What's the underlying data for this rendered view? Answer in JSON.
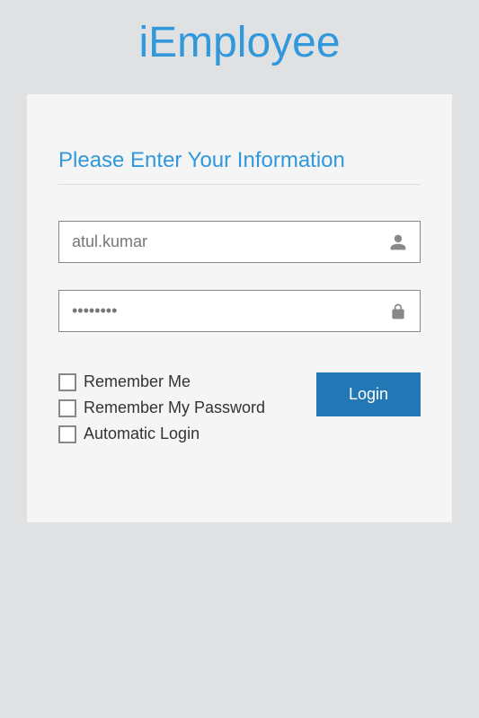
{
  "app": {
    "title": "iEmployee"
  },
  "form": {
    "heading": "Please Enter Your Information",
    "username_value": "atul.kumar",
    "password_value": "••••••••",
    "checks": {
      "remember_me": "Remember Me",
      "remember_password": "Remember My Password",
      "auto_login": "Automatic Login"
    },
    "login_button": "Login"
  }
}
